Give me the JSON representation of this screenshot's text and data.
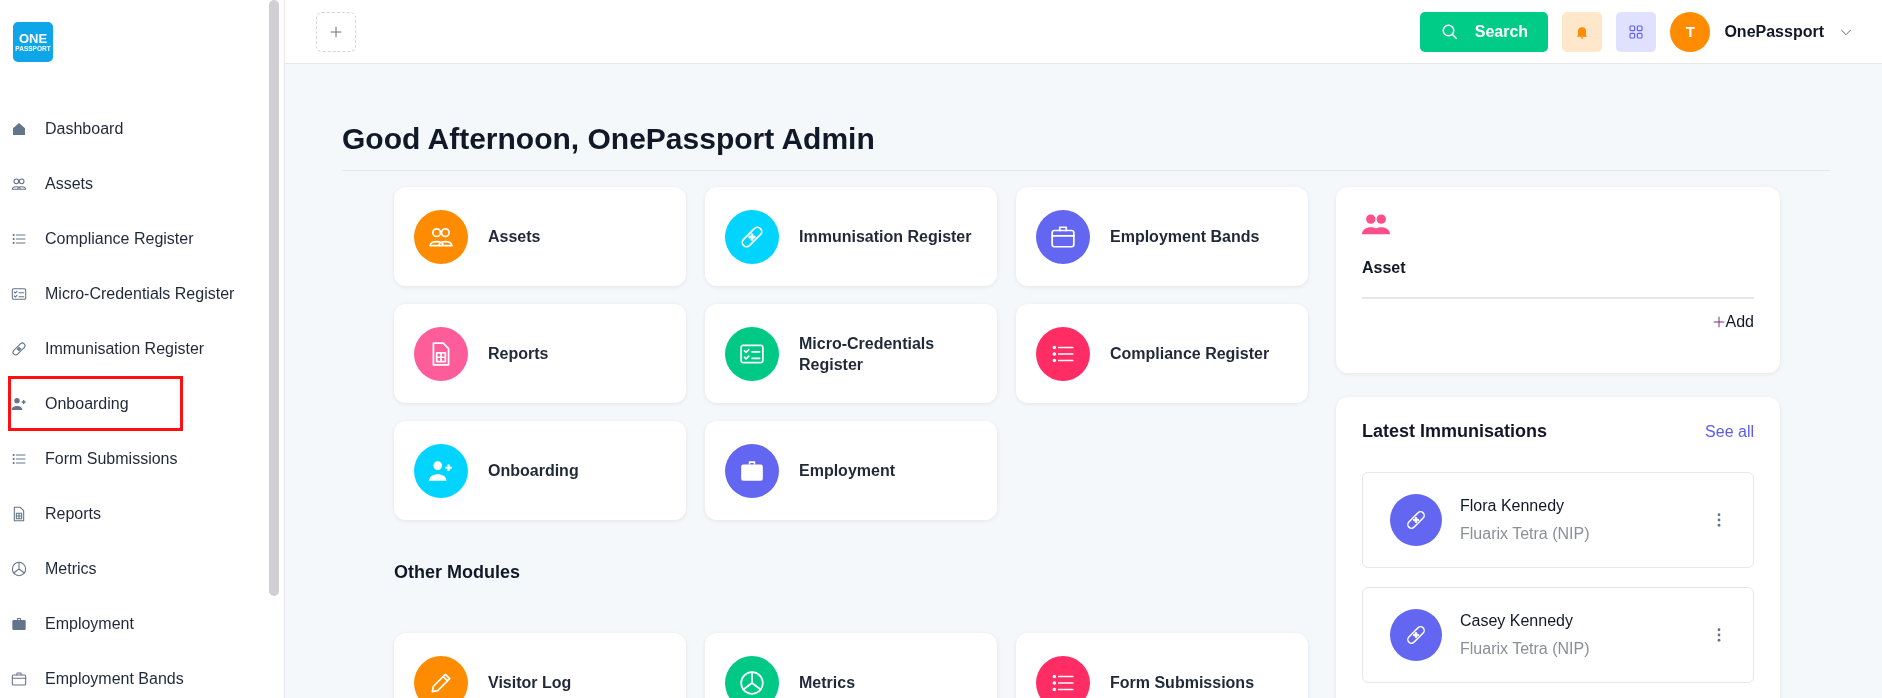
{
  "sidebar": {
    "logo": {
      "line1": "ONE",
      "line2": "PASSPORT"
    },
    "items": [
      {
        "label": "Dashboard",
        "kind": "home",
        "highlighted": false
      },
      {
        "label": "Assets",
        "kind": "people",
        "highlighted": false
      },
      {
        "label": "Compliance Register",
        "kind": "list",
        "highlighted": false
      },
      {
        "label": "Micro-Credentials Register",
        "kind": "idcard",
        "highlighted": false
      },
      {
        "label": "Immunisation Register",
        "kind": "bandage",
        "highlighted": false
      },
      {
        "label": "Onboarding",
        "kind": "userplus",
        "highlighted": true
      },
      {
        "label": "Form Submissions",
        "kind": "list",
        "highlighted": false
      },
      {
        "label": "Reports",
        "kind": "sheet",
        "highlighted": false
      },
      {
        "label": "Metrics",
        "kind": "pie",
        "highlighted": false
      },
      {
        "label": "Employment",
        "kind": "briefcase",
        "highlighted": false
      },
      {
        "label": "Employment Bands",
        "kind": "briefcase-outline",
        "highlighted": false
      }
    ]
  },
  "topbar": {
    "search_button": "Search",
    "user": {
      "initial": "T",
      "name": "OnePassport"
    }
  },
  "greeting": "Good Afternoon, OnePassport Admin",
  "modules": [
    {
      "label": "Assets",
      "kind": "people",
      "color": "#ff8c00"
    },
    {
      "label": "Immunisation Register",
      "kind": "bandage",
      "color": "#00d4ff"
    },
    {
      "label": "Employment Bands",
      "kind": "briefcase-outline",
      "color": "#6366f1"
    },
    {
      "label": "Reports",
      "kind": "sheet",
      "color": "#ff5c9a"
    },
    {
      "label": "Micro-Credentials Register",
      "kind": "idcard",
      "color": "#00c986"
    },
    {
      "label": "Compliance Register",
      "kind": "list",
      "color": "#ff2d63"
    },
    {
      "label": "Onboarding",
      "kind": "userplus",
      "color": "#00d4ff"
    },
    {
      "label": "Employment",
      "kind": "briefcase",
      "color": "#6366f1"
    }
  ],
  "other_modules": {
    "title": "Other Modules",
    "items": [
      {
        "label": "Visitor Log",
        "kind": "pencil",
        "color": "#ff8c00"
      },
      {
        "label": "Metrics",
        "kind": "pie",
        "color": "#00c986"
      },
      {
        "label": "Form Submissions",
        "kind": "list",
        "color": "#ff2d63"
      }
    ]
  },
  "asset_card": {
    "title": "Asset",
    "add_link": "Add"
  },
  "latest_immunisations": {
    "title": "Latest Immunisations",
    "see_all": "See all",
    "items": [
      {
        "name": "Flora Kennedy",
        "vaccine": "Fluarix Tetra (NIP)"
      },
      {
        "name": "Casey Kennedy",
        "vaccine": "Fluarix Tetra (NIP)"
      }
    ]
  }
}
